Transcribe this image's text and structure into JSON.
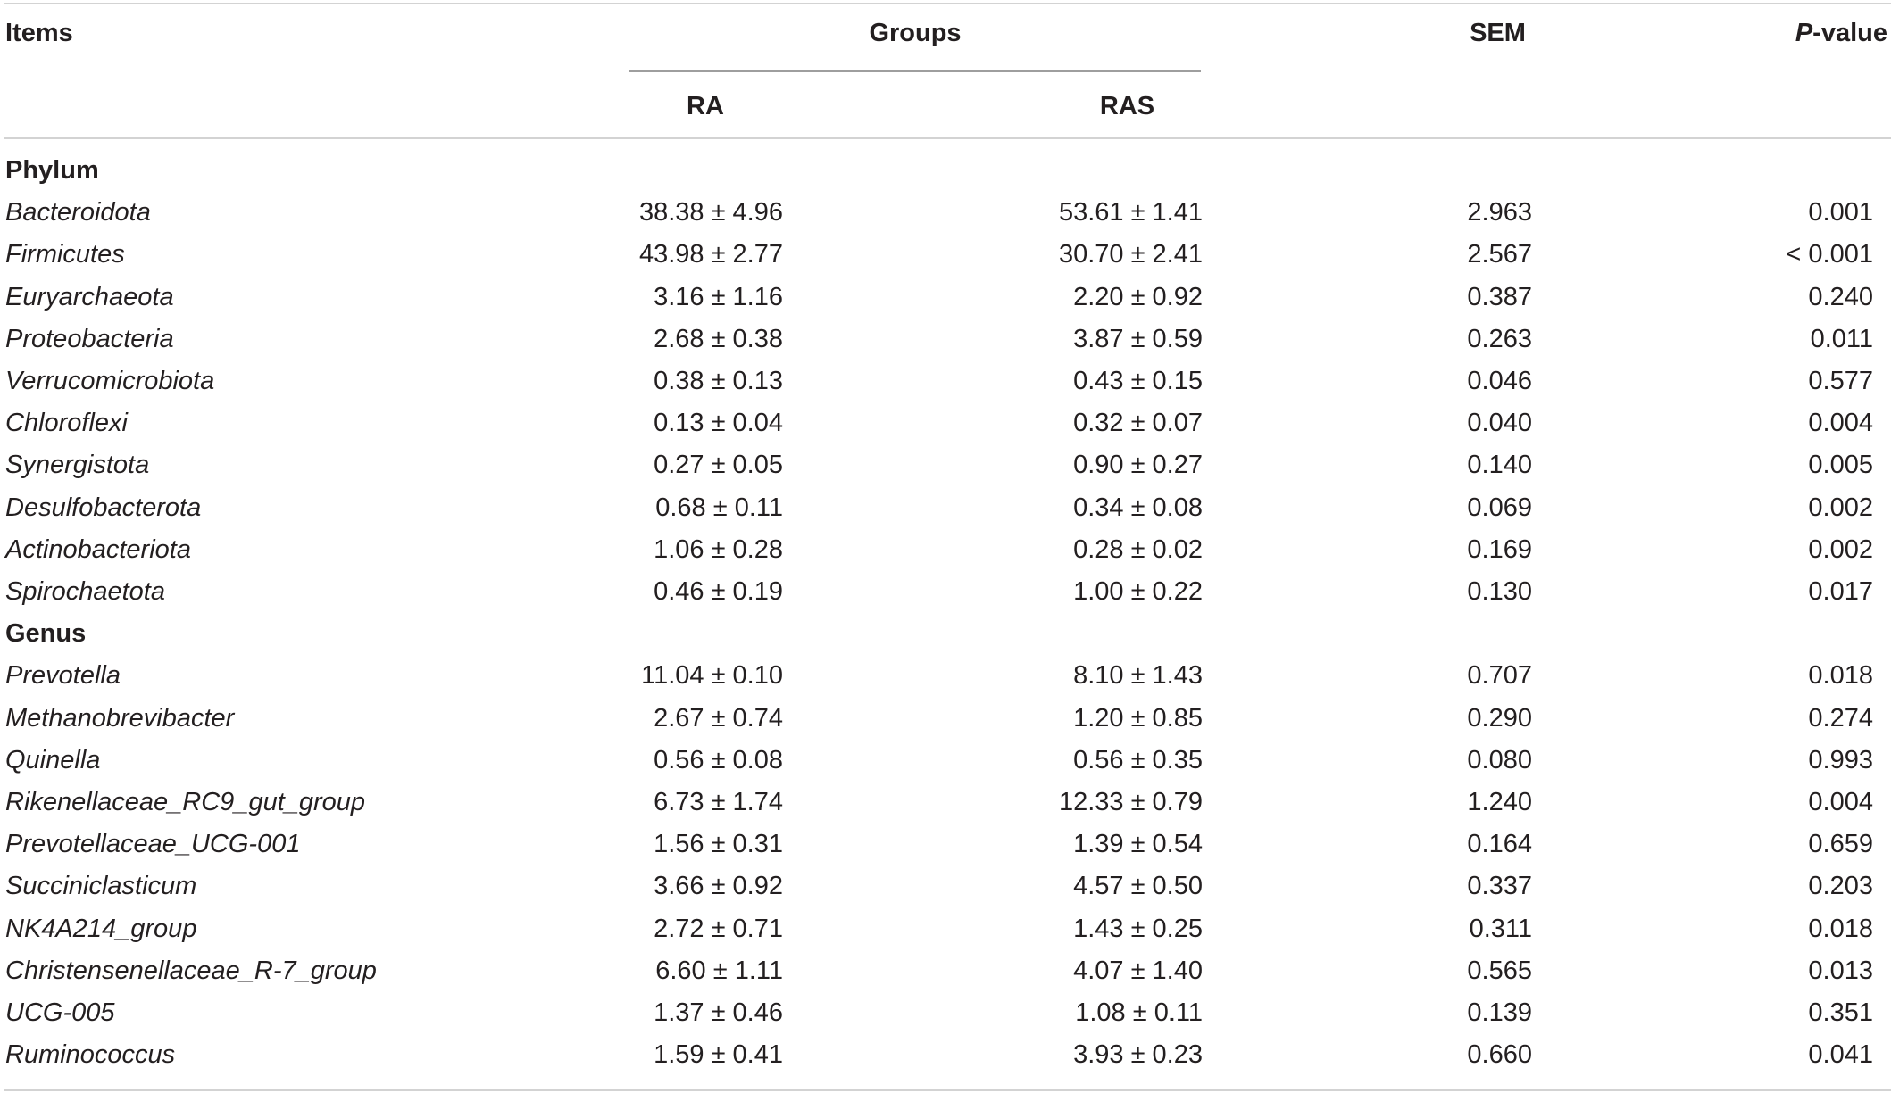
{
  "headers": {
    "items": "Items",
    "groups": "Groups",
    "ra": "RA",
    "ras": "RAS",
    "sem": "SEM",
    "p_italic": "P",
    "p_rest": "-value"
  },
  "sections": [
    {
      "label": "Phylum",
      "rows": [
        {
          "name": "Bacteroidota",
          "ra": "38.38 ± 4.96",
          "ras": "53.61 ± 1.41",
          "sem": "2.963",
          "p": "0.001"
        },
        {
          "name": "Firmicutes",
          "ra": "43.98 ± 2.77",
          "ras": "30.70 ± 2.41",
          "sem": "2.567",
          "p": "< 0.001"
        },
        {
          "name": "Euryarchaeota",
          "ra": "3.16 ± 1.16",
          "ras": "2.20 ± 0.92",
          "sem": "0.387",
          "p": "0.240"
        },
        {
          "name": "Proteobacteria",
          "ra": "2.68 ± 0.38",
          "ras": "3.87 ± 0.59",
          "sem": "0.263",
          "p": "0.011"
        },
        {
          "name": "Verrucomicrobiota",
          "ra": "0.38 ± 0.13",
          "ras": "0.43 ± 0.15",
          "sem": "0.046",
          "p": "0.577"
        },
        {
          "name": "Chloroflexi",
          "ra": "0.13 ± 0.04",
          "ras": "0.32 ± 0.07",
          "sem": "0.040",
          "p": "0.004"
        },
        {
          "name": "Synergistota",
          "ra": "0.27 ± 0.05",
          "ras": "0.90 ± 0.27",
          "sem": "0.140",
          "p": "0.005"
        },
        {
          "name": "Desulfobacterota",
          "ra": "0.68 ± 0.11",
          "ras": "0.34 ± 0.08",
          "sem": "0.069",
          "p": "0.002"
        },
        {
          "name": "Actinobacteriota",
          "ra": "1.06 ± 0.28",
          "ras": "0.28 ± 0.02",
          "sem": "0.169",
          "p": "0.002"
        },
        {
          "name": "Spirochaetota",
          "ra": "0.46 ± 0.19",
          "ras": "1.00 ± 0.22",
          "sem": "0.130",
          "p": "0.017"
        }
      ]
    },
    {
      "label": "Genus",
      "rows": [
        {
          "name": "Prevotella",
          "ra": "11.04 ± 0.10",
          "ras": "8.10 ± 1.43",
          "sem": "0.707",
          "p": "0.018"
        },
        {
          "name": "Methanobrevibacter",
          "ra": "2.67 ± 0.74",
          "ras": "1.20 ± 0.85",
          "sem": "0.290",
          "p": "0.274"
        },
        {
          "name": "Quinella",
          "ra": "0.56 ± 0.08",
          "ras": "0.56 ± 0.35",
          "sem": "0.080",
          "p": "0.993"
        },
        {
          "name": "Rikenellaceae_RC9_gut_group",
          "ra": "6.73 ± 1.74",
          "ras": "12.33 ± 0.79",
          "sem": "1.240",
          "p": "0.004"
        },
        {
          "name": "Prevotellaceae_UCG-001",
          "ra": "1.56 ± 0.31",
          "ras": "1.39 ± 0.54",
          "sem": "0.164",
          "p": "0.659"
        },
        {
          "name": "Succiniclasticum",
          "ra": "3.66 ± 0.92",
          "ras": "4.57 ± 0.50",
          "sem": "0.337",
          "p": "0.203"
        },
        {
          "name": "NK4A214_group",
          "ra": "2.72 ± 0.71",
          "ras": "1.43 ± 0.25",
          "sem": "0.311",
          "p": "0.018"
        },
        {
          "name": "Christensenellaceae_R-7_group",
          "ra": "6.60 ± 1.11",
          "ras": "4.07 ± 1.40",
          "sem": "0.565",
          "p": "0.013"
        },
        {
          "name": "UCG-005",
          "ra": "1.37 ± 0.46",
          "ras": "1.08 ± 0.11",
          "sem": "0.139",
          "p": "0.351"
        },
        {
          "name": "Ruminococcus",
          "ra": "1.59 ± 0.41",
          "ras": "3.93 ± 0.23",
          "sem": "0.660",
          "p": "0.041"
        }
      ]
    }
  ]
}
